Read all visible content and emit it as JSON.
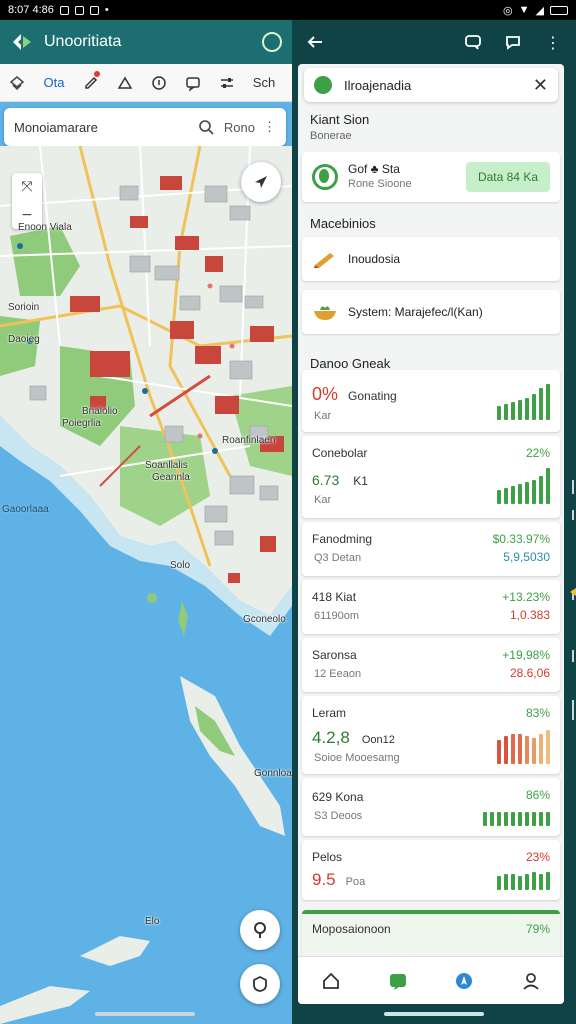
{
  "status_bar": {
    "time": "8:07 4:86"
  },
  "left": {
    "app_title": "Unooritiata",
    "tools": [
      "Ota",
      "Sch"
    ],
    "search": {
      "value": "Monoiamarare",
      "filter_label": "Rono"
    },
    "map_labels": {
      "l1": "Enoon Viala",
      "l2": "Sorioin",
      "l3": "Daoieg",
      "l4": "Poiegrlia",
      "l5": "Brialolio",
      "l6": "Roanfinlaen",
      "l7": "Soanllalis",
      "l8": "Geannla",
      "l9": "Gaoorlaaa",
      "l10": "Solo",
      "l11": "Gconeolo",
      "l12": "Gonnloa",
      "l13": "Elo"
    },
    "colors": {
      "appbar": "#1c6e70",
      "water": "#5fb2e6",
      "land": "#e9eee9",
      "park": "#8fcb7a",
      "roof": "#c8463c"
    }
  },
  "right": {
    "place_card": {
      "title": "Ilroajenadia"
    },
    "location": {
      "title": "Kiant Sion",
      "subtitle": "Bonerae"
    },
    "status": {
      "title": "Gof ♣ Sta",
      "subtitle": "Rone Sioone",
      "button": "Data 84 Ka"
    },
    "section_mappings": "Macebinios",
    "menu": [
      {
        "label": "Inoudosia",
        "icon": "pencil-icon"
      },
      {
        "label": "System:  Marajefec/l(Kan)",
        "icon": "bowl-icon"
      }
    ],
    "dash_title": "Danoo Gneak",
    "metrics": [
      {
        "value": "0%",
        "label": "Gonating",
        "sub": "Kar"
      },
      {
        "title": "Conebolar",
        "pct": "22%",
        "value": "6.73",
        "label": "K1",
        "sub": "Kar"
      },
      {
        "title": "Fanodming",
        "pct": "$0.33.97%",
        "pct2": "5,9,5030",
        "sub": "Q3 Detan"
      },
      {
        "title": "418 Kiat",
        "pct": "+13.23%",
        "pct2": "1,0.383",
        "sub": "61190om"
      },
      {
        "title": "Saronsa",
        "pct": "+19,98%",
        "pct2": "28.6,06",
        "sub": "12 Eeaon"
      },
      {
        "title": "Leram",
        "pct": "83%",
        "value": "4.2,8",
        "label": "Oon12",
        "sub": "Soioe Mooesamg"
      },
      {
        "title": "629 Kona",
        "pct": "86%",
        "sub": "S3 Deoos"
      },
      {
        "title": "Pelos",
        "pct": "23%",
        "value": "9.5",
        "label": "Poa"
      },
      {
        "title": "Moposaionoon",
        "pct": "79%"
      }
    ],
    "colors": {
      "green": "#3da047",
      "red": "#d33c2e",
      "orange": "#e8955a",
      "teal": "#0f4346"
    }
  }
}
